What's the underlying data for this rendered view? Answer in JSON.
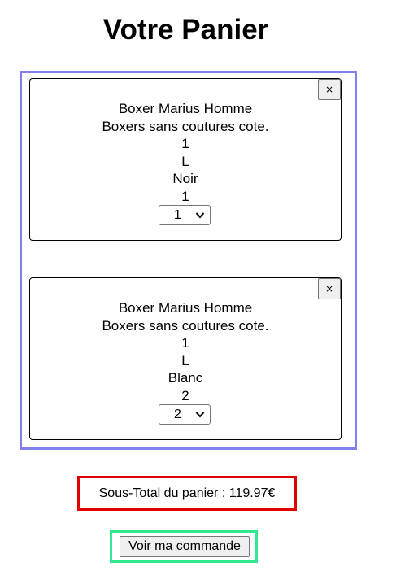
{
  "page": {
    "title": "Votre Panier"
  },
  "cart": {
    "items": [
      {
        "name": "Boxer Marius Homme",
        "description": "Boxers sans coutures cote.",
        "line3": "1",
        "size": "L",
        "color": "Noir",
        "quantity_text": "1",
        "quantity_selected": "1",
        "remove_label": "×"
      },
      {
        "name": "Boxer Marius Homme",
        "description": "Boxers sans coutures cote.",
        "line3": "1",
        "size": "L",
        "color": "Blanc",
        "quantity_text": "2",
        "quantity_selected": "2",
        "remove_label": "×"
      }
    ]
  },
  "summary": {
    "subtotal_text": "Sous-Total du panier : 119.97€"
  },
  "actions": {
    "view_order_label": "Voir ma commande"
  },
  "colors": {
    "cart_border": "#8080f0",
    "subtotal_border": "#e00000",
    "order_border": "#30e890"
  }
}
